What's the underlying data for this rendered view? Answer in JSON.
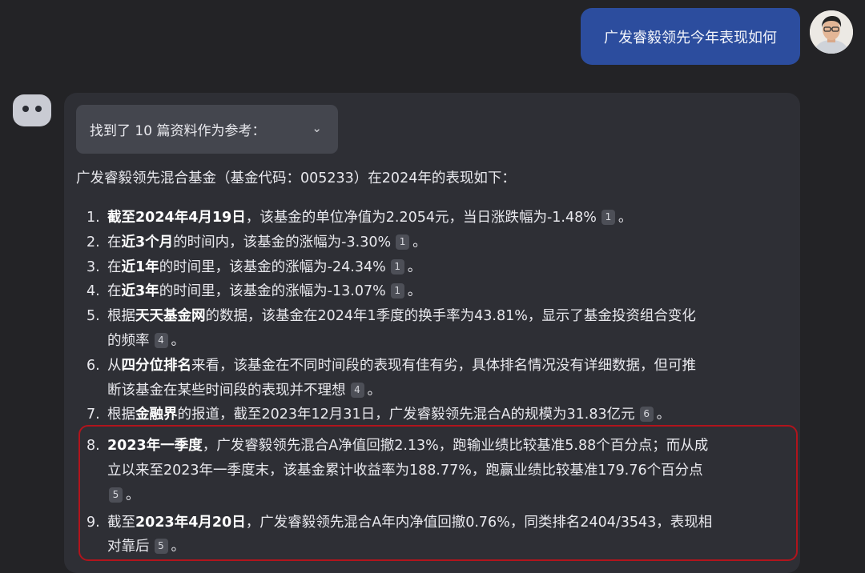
{
  "user_message": "广发睿毅领先今年表现如何",
  "refs_toggle": {
    "label": "找到了 10 篇资料作为参考：",
    "icon": "chevron-down-icon"
  },
  "intro": "广发睿毅领先混合基金（基金代码：005233）在2024年的表现如下：",
  "items": [
    {
      "n": "1.",
      "lines": [
        {
          "bold": "截至2024年4月19日",
          "rest": "，该基金的单位净值为2.2054元，当日涨跌幅为-1.48%",
          "cite": "1",
          "end": "。"
        }
      ]
    },
    {
      "n": "2.",
      "lines": [
        {
          "pre": "在",
          "bold": "近3个月",
          "rest": "的时间内，该基金的涨幅为-3.30%",
          "cite": "1",
          "end": "。"
        }
      ]
    },
    {
      "n": "3.",
      "lines": [
        {
          "pre": "在",
          "bold": "近1年",
          "rest": "的时间里，该基金的涨幅为-24.34%",
          "cite": "1",
          "end": "。"
        }
      ]
    },
    {
      "n": "4.",
      "lines": [
        {
          "pre": "在",
          "bold": "近3年",
          "rest": "的时间里，该基金的涨幅为-13.07%",
          "cite": "1",
          "end": "。"
        }
      ]
    },
    {
      "n": "5.",
      "lines": [
        {
          "pre": "根据",
          "bold": "天天基金网",
          "rest": "的数据，该基金在2024年1季度的换手率为43.81%，显示了基金投资组合变化"
        },
        {
          "rest": "的频率",
          "cite": "4",
          "end": "。"
        }
      ]
    },
    {
      "n": "6.",
      "lines": [
        {
          "pre": "从",
          "bold": "四分位排名",
          "rest": "来看，该基金在不同时间段的表现有佳有劣，具体排名情况没有详细数据，但可推"
        },
        {
          "rest": "断该基金在某些时间段的表现并不理想",
          "cite": "4",
          "end": "。"
        }
      ]
    },
    {
      "n": "7.",
      "lines": [
        {
          "pre": "根据",
          "bold": "金融界",
          "rest": "的报道，截至2023年12月31日，广发睿毅领先混合A的规模为31.83亿元",
          "cite": "6",
          "end": "。"
        }
      ]
    },
    {
      "n": "8.",
      "lines": [
        {
          "bold": "2023年一季度",
          "rest": "，广发睿毅领先混合A净值回撤2.13%，跑输业绩比较基准5.88个百分点；而从成"
        },
        {
          "rest": "立以来至2023年一季度末，该基金累计收益率为188.77%，跑赢业绩比较基准179.76个百分点"
        },
        {
          "cite": "5",
          "end": "。"
        }
      ]
    },
    {
      "n": "9.",
      "lines": [
        {
          "pre": "截至",
          "bold": "2023年4月20日",
          "rest": "，广发睿毅领先混合A年内净值回撤0.76%，同类排名2404/3543，表现相"
        },
        {
          "rest": "对靠后",
          "cite": "5",
          "end": "。"
        }
      ]
    }
  ]
}
